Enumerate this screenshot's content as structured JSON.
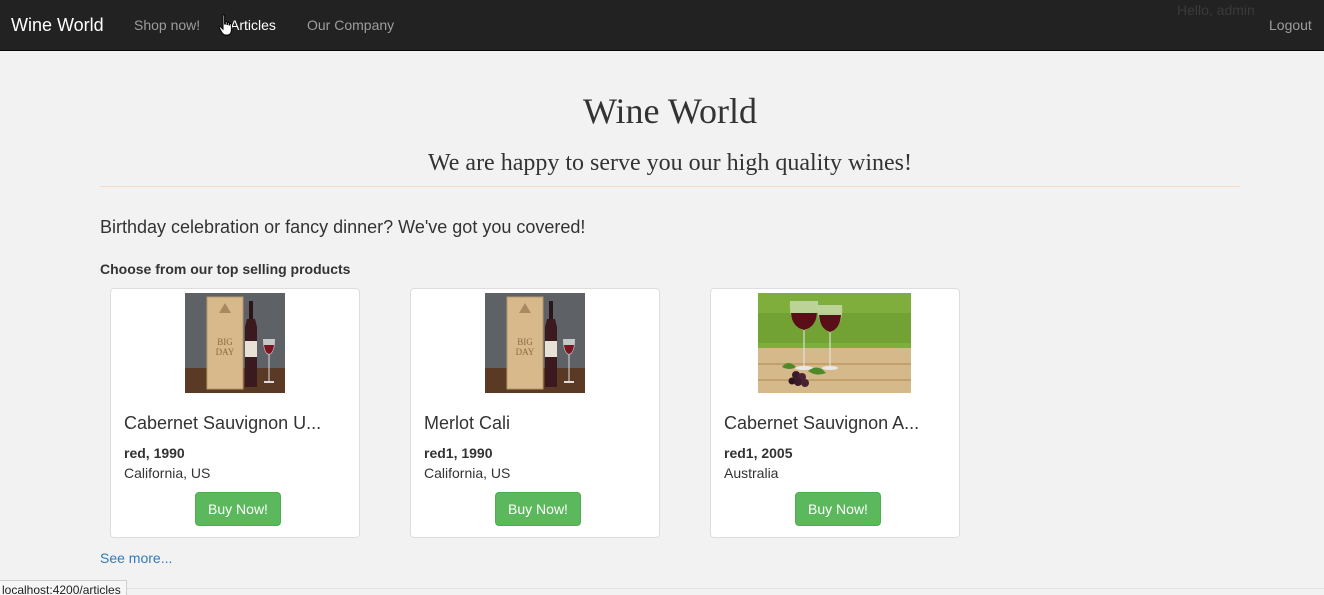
{
  "navbar": {
    "brand": "Wine World",
    "links": [
      {
        "label": "Shop now!"
      },
      {
        "label": "Articles"
      },
      {
        "label": "Our Company"
      }
    ],
    "greeting": "Hello, admin",
    "logout": "Logout"
  },
  "hero": {
    "title": "Wine World",
    "subtitle": "We are happy to serve you our high quality wines!"
  },
  "intro": {
    "lead": "Birthday celebration or fancy dinner? We've got you covered!",
    "heading": "Choose from our top selling products"
  },
  "products": [
    {
      "name": "Cabernet Sauvignon U...",
      "meta": "red, 1990",
      "origin": "California, US",
      "button": "Buy Now!",
      "image": "wine-box-bottle-glass"
    },
    {
      "name": "Merlot Cali",
      "meta": "red1, 1990",
      "origin": "California, US",
      "button": "Buy Now!",
      "image": "wine-box-bottle-glass"
    },
    {
      "name": "Cabernet Sauvignon A...",
      "meta": "red1, 2005",
      "origin": "Australia",
      "button": "Buy Now!",
      "image": "wine-glasses-grapes"
    }
  ],
  "see_more": "See more...",
  "status_url": "localhost:4200/articles",
  "colors": {
    "navbar_bg": "#222222",
    "buy_button": "#5cb85c",
    "link": "#337ab7",
    "rule": "#f5dcc4"
  }
}
